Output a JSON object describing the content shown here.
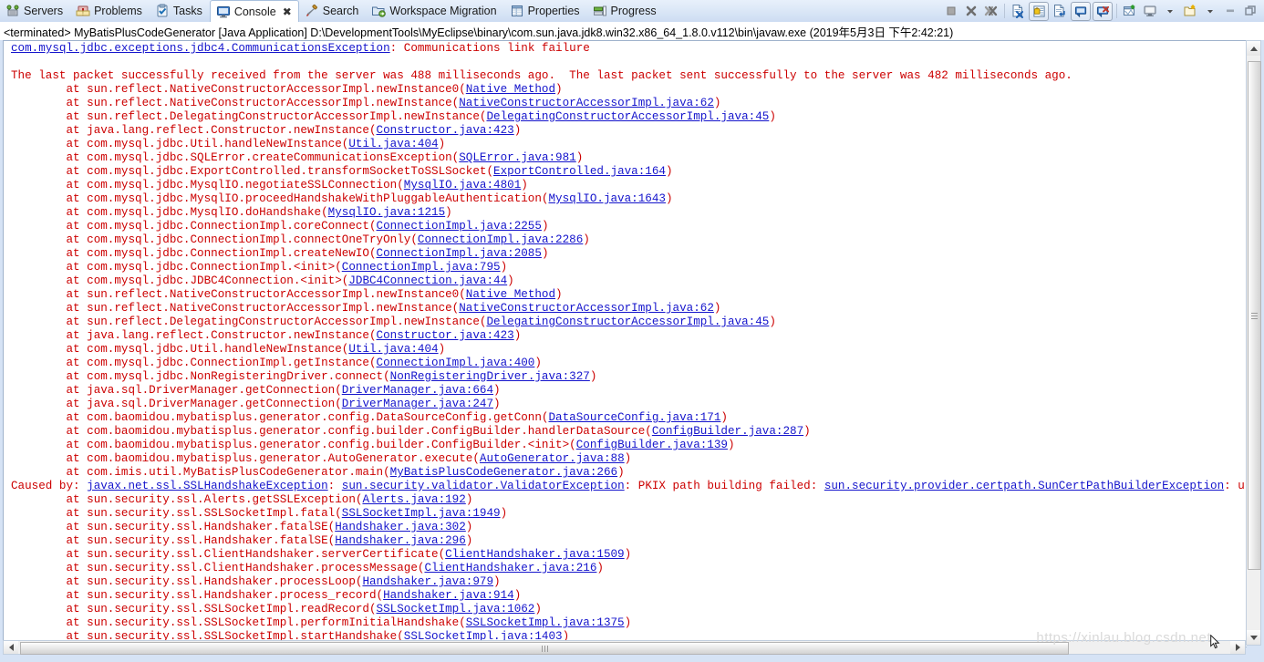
{
  "window": {
    "tabs": [
      {
        "label": "Servers",
        "icon": "servers-icon",
        "active": false
      },
      {
        "label": "Problems",
        "icon": "problems-icon",
        "active": false
      },
      {
        "label": "Tasks",
        "icon": "tasks-icon",
        "active": false
      },
      {
        "label": "Console",
        "icon": "console-icon",
        "active": true,
        "close": "✖"
      },
      {
        "label": "Search",
        "icon": "search-icon",
        "active": false
      },
      {
        "label": "Workspace Migration",
        "icon": "workspace-migration-icon",
        "active": false
      },
      {
        "label": "Properties",
        "icon": "properties-icon",
        "active": false
      },
      {
        "label": "Progress",
        "icon": "progress-icon",
        "active": false
      }
    ],
    "toolbar": [
      {
        "name": "terminate-button",
        "title": "Terminate"
      },
      {
        "name": "remove-launch-button",
        "title": "Remove Launch"
      },
      {
        "name": "remove-all-terminated-button",
        "title": "Remove All Terminated Launches"
      },
      {
        "name": "clear-console-button",
        "title": "Clear Console"
      },
      {
        "name": "scroll-lock-button",
        "title": "Scroll Lock"
      },
      {
        "name": "word-wrap-button",
        "title": "Word Wrap"
      },
      {
        "name": "pin-console-button",
        "title": "Pin Console"
      },
      {
        "name": "display-selected-console-button",
        "title": "Display Selected Console"
      },
      {
        "name": "open-console-button",
        "title": "Open Console"
      },
      {
        "name": "open-console-dropdown",
        "title": "Open Console Menu"
      },
      {
        "name": "new-console-view-button",
        "title": "New Console View"
      },
      {
        "name": "view-menu-dropdown",
        "title": "View Menu"
      },
      {
        "name": "minimize-button",
        "title": "Minimize"
      },
      {
        "name": "maximize-button",
        "title": "Maximize"
      }
    ]
  },
  "console": {
    "header": "<terminated> MyBatisPlusCodeGenerator [Java Application] D:\\DevelopmentTools\\MyEclipse\\binary\\com.sun.java.jdk8.win32.x86_64_1.8.0.v112\\bin\\javaw.exe (2019年5月3日 下午2:42:21)",
    "colors": {
      "text": "#cc0000",
      "link": "#1414cc",
      "background": "#ffffff"
    },
    "lines": [
      [
        {
          "t": "com.mysql.jdbc.exceptions.jdbc4.CommunicationsException",
          "k": "link"
        },
        {
          "t": ": Communications link failure",
          "k": "red"
        }
      ],
      [],
      [
        {
          "t": "The last packet successfully received from the server was 488 milliseconds ago.  The last packet sent successfully to the server was 482 milliseconds ago.",
          "k": "red"
        }
      ],
      [
        {
          "t": "\tat sun.reflect.NativeConstructorAccessorImpl.newInstance0(",
          "k": "red"
        },
        {
          "t": "Native Method",
          "k": "link"
        },
        {
          "t": ")",
          "k": "red"
        }
      ],
      [
        {
          "t": "\tat sun.reflect.NativeConstructorAccessorImpl.newInstance(",
          "k": "red"
        },
        {
          "t": "NativeConstructorAccessorImpl.java:62",
          "k": "link"
        },
        {
          "t": ")",
          "k": "red"
        }
      ],
      [
        {
          "t": "\tat sun.reflect.DelegatingConstructorAccessorImpl.newInstance(",
          "k": "red"
        },
        {
          "t": "DelegatingConstructorAccessorImpl.java:45",
          "k": "link"
        },
        {
          "t": ")",
          "k": "red"
        }
      ],
      [
        {
          "t": "\tat java.lang.reflect.Constructor.newInstance(",
          "k": "red"
        },
        {
          "t": "Constructor.java:423",
          "k": "link"
        },
        {
          "t": ")",
          "k": "red"
        }
      ],
      [
        {
          "t": "\tat com.mysql.jdbc.Util.handleNewInstance(",
          "k": "red"
        },
        {
          "t": "Util.java:404",
          "k": "link"
        },
        {
          "t": ")",
          "k": "red"
        }
      ],
      [
        {
          "t": "\tat com.mysql.jdbc.SQLError.createCommunicationsException(",
          "k": "red"
        },
        {
          "t": "SQLError.java:981",
          "k": "link"
        },
        {
          "t": ")",
          "k": "red"
        }
      ],
      [
        {
          "t": "\tat com.mysql.jdbc.ExportControlled.transformSocketToSSLSocket(",
          "k": "red"
        },
        {
          "t": "ExportControlled.java:164",
          "k": "link"
        },
        {
          "t": ")",
          "k": "red"
        }
      ],
      [
        {
          "t": "\tat com.mysql.jdbc.MysqlIO.negotiateSSLConnection(",
          "k": "red"
        },
        {
          "t": "MysqlIO.java:4801",
          "k": "link"
        },
        {
          "t": ")",
          "k": "red"
        }
      ],
      [
        {
          "t": "\tat com.mysql.jdbc.MysqlIO.proceedHandshakeWithPluggableAuthentication(",
          "k": "red"
        },
        {
          "t": "MysqlIO.java:1643",
          "k": "link"
        },
        {
          "t": ")",
          "k": "red"
        }
      ],
      [
        {
          "t": "\tat com.mysql.jdbc.MysqlIO.doHandshake(",
          "k": "red"
        },
        {
          "t": "MysqlIO.java:1215",
          "k": "link"
        },
        {
          "t": ")",
          "k": "red"
        }
      ],
      [
        {
          "t": "\tat com.mysql.jdbc.ConnectionImpl.coreConnect(",
          "k": "red"
        },
        {
          "t": "ConnectionImpl.java:2255",
          "k": "link"
        },
        {
          "t": ")",
          "k": "red"
        }
      ],
      [
        {
          "t": "\tat com.mysql.jdbc.ConnectionImpl.connectOneTryOnly(",
          "k": "red"
        },
        {
          "t": "ConnectionImpl.java:2286",
          "k": "link"
        },
        {
          "t": ")",
          "k": "red"
        }
      ],
      [
        {
          "t": "\tat com.mysql.jdbc.ConnectionImpl.createNewIO(",
          "k": "red"
        },
        {
          "t": "ConnectionImpl.java:2085",
          "k": "link"
        },
        {
          "t": ")",
          "k": "red"
        }
      ],
      [
        {
          "t": "\tat com.mysql.jdbc.ConnectionImpl.<init>(",
          "k": "red"
        },
        {
          "t": "ConnectionImpl.java:795",
          "k": "link"
        },
        {
          "t": ")",
          "k": "red"
        }
      ],
      [
        {
          "t": "\tat com.mysql.jdbc.JDBC4Connection.<init>(",
          "k": "red"
        },
        {
          "t": "JDBC4Connection.java:44",
          "k": "link"
        },
        {
          "t": ")",
          "k": "red"
        }
      ],
      [
        {
          "t": "\tat sun.reflect.NativeConstructorAccessorImpl.newInstance0(",
          "k": "red"
        },
        {
          "t": "Native Method",
          "k": "link"
        },
        {
          "t": ")",
          "k": "red"
        }
      ],
      [
        {
          "t": "\tat sun.reflect.NativeConstructorAccessorImpl.newInstance(",
          "k": "red"
        },
        {
          "t": "NativeConstructorAccessorImpl.java:62",
          "k": "link"
        },
        {
          "t": ")",
          "k": "red"
        }
      ],
      [
        {
          "t": "\tat sun.reflect.DelegatingConstructorAccessorImpl.newInstance(",
          "k": "red"
        },
        {
          "t": "DelegatingConstructorAccessorImpl.java:45",
          "k": "link"
        },
        {
          "t": ")",
          "k": "red"
        }
      ],
      [
        {
          "t": "\tat java.lang.reflect.Constructor.newInstance(",
          "k": "red"
        },
        {
          "t": "Constructor.java:423",
          "k": "link"
        },
        {
          "t": ")",
          "k": "red"
        }
      ],
      [
        {
          "t": "\tat com.mysql.jdbc.Util.handleNewInstance(",
          "k": "red"
        },
        {
          "t": "Util.java:404",
          "k": "link"
        },
        {
          "t": ")",
          "k": "red"
        }
      ],
      [
        {
          "t": "\tat com.mysql.jdbc.ConnectionImpl.getInstance(",
          "k": "red"
        },
        {
          "t": "ConnectionImpl.java:400",
          "k": "link"
        },
        {
          "t": ")",
          "k": "red"
        }
      ],
      [
        {
          "t": "\tat com.mysql.jdbc.NonRegisteringDriver.connect(",
          "k": "red"
        },
        {
          "t": "NonRegisteringDriver.java:327",
          "k": "link"
        },
        {
          "t": ")",
          "k": "red"
        }
      ],
      [
        {
          "t": "\tat java.sql.DriverManager.getConnection(",
          "k": "red"
        },
        {
          "t": "DriverManager.java:664",
          "k": "link"
        },
        {
          "t": ")",
          "k": "red"
        }
      ],
      [
        {
          "t": "\tat java.sql.DriverManager.getConnection(",
          "k": "red"
        },
        {
          "t": "DriverManager.java:247",
          "k": "link"
        },
        {
          "t": ")",
          "k": "red"
        }
      ],
      [
        {
          "t": "\tat com.baomidou.mybatisplus.generator.config.DataSourceConfig.getConn(",
          "k": "red"
        },
        {
          "t": "DataSourceConfig.java:171",
          "k": "link"
        },
        {
          "t": ")",
          "k": "red"
        }
      ],
      [
        {
          "t": "\tat com.baomidou.mybatisplus.generator.config.builder.ConfigBuilder.handlerDataSource(",
          "k": "red"
        },
        {
          "t": "ConfigBuilder.java:287",
          "k": "link"
        },
        {
          "t": ")",
          "k": "red"
        }
      ],
      [
        {
          "t": "\tat com.baomidou.mybatisplus.generator.config.builder.ConfigBuilder.<init>(",
          "k": "red"
        },
        {
          "t": "ConfigBuilder.java:139",
          "k": "link"
        },
        {
          "t": ")",
          "k": "red"
        }
      ],
      [
        {
          "t": "\tat com.baomidou.mybatisplus.generator.AutoGenerator.execute(",
          "k": "red"
        },
        {
          "t": "AutoGenerator.java:88",
          "k": "link"
        },
        {
          "t": ")",
          "k": "red"
        }
      ],
      [
        {
          "t": "\tat com.imis.util.MyBatisPlusCodeGenerator.main(",
          "k": "red"
        },
        {
          "t": "MyBatisPlusCodeGenerator.java:266",
          "k": "link"
        },
        {
          "t": ")",
          "k": "red"
        }
      ],
      [
        {
          "t": "Caused by: ",
          "k": "red"
        },
        {
          "t": "javax.net.ssl.SSLHandshakeException",
          "k": "link"
        },
        {
          "t": ": ",
          "k": "red"
        },
        {
          "t": "sun.security.validator.ValidatorException",
          "k": "link"
        },
        {
          "t": ": PKIX path building failed: ",
          "k": "red"
        },
        {
          "t": "sun.security.provider.certpath.SunCertPathBuilderException",
          "k": "link"
        },
        {
          "t": ": unable to find",
          "k": "red"
        }
      ],
      [
        {
          "t": "\tat sun.security.ssl.Alerts.getSSLException(",
          "k": "red"
        },
        {
          "t": "Alerts.java:192",
          "k": "link"
        },
        {
          "t": ")",
          "k": "red"
        }
      ],
      [
        {
          "t": "\tat sun.security.ssl.SSLSocketImpl.fatal(",
          "k": "red"
        },
        {
          "t": "SSLSocketImpl.java:1949",
          "k": "link"
        },
        {
          "t": ")",
          "k": "red"
        }
      ],
      [
        {
          "t": "\tat sun.security.ssl.Handshaker.fatalSE(",
          "k": "red"
        },
        {
          "t": "Handshaker.java:302",
          "k": "link"
        },
        {
          "t": ")",
          "k": "red"
        }
      ],
      [
        {
          "t": "\tat sun.security.ssl.Handshaker.fatalSE(",
          "k": "red"
        },
        {
          "t": "Handshaker.java:296",
          "k": "link"
        },
        {
          "t": ")",
          "k": "red"
        }
      ],
      [
        {
          "t": "\tat sun.security.ssl.ClientHandshaker.serverCertificate(",
          "k": "red"
        },
        {
          "t": "ClientHandshaker.java:1509",
          "k": "link"
        },
        {
          "t": ")",
          "k": "red"
        }
      ],
      [
        {
          "t": "\tat sun.security.ssl.ClientHandshaker.processMessage(",
          "k": "red"
        },
        {
          "t": "ClientHandshaker.java:216",
          "k": "link"
        },
        {
          "t": ")",
          "k": "red"
        }
      ],
      [
        {
          "t": "\tat sun.security.ssl.Handshaker.processLoop(",
          "k": "red"
        },
        {
          "t": "Handshaker.java:979",
          "k": "link"
        },
        {
          "t": ")",
          "k": "red"
        }
      ],
      [
        {
          "t": "\tat sun.security.ssl.Handshaker.process_record(",
          "k": "red"
        },
        {
          "t": "Handshaker.java:914",
          "k": "link"
        },
        {
          "t": ")",
          "k": "red"
        }
      ],
      [
        {
          "t": "\tat sun.security.ssl.SSLSocketImpl.readRecord(",
          "k": "red"
        },
        {
          "t": "SSLSocketImpl.java:1062",
          "k": "link"
        },
        {
          "t": ")",
          "k": "red"
        }
      ],
      [
        {
          "t": "\tat sun.security.ssl.SSLSocketImpl.performInitialHandshake(",
          "k": "red"
        },
        {
          "t": "SSLSocketImpl.java:1375",
          "k": "link"
        },
        {
          "t": ")",
          "k": "red"
        }
      ],
      [
        {
          "t": "\tat sun.security.ssl.SSLSocketImpl.startHandshake(",
          "k": "red"
        },
        {
          "t": "SSLSocketImpl.java:1403",
          "k": "link"
        },
        {
          "t": ")",
          "k": "red"
        }
      ]
    ]
  },
  "watermark": "https://xinlau.blog.csdn.net"
}
